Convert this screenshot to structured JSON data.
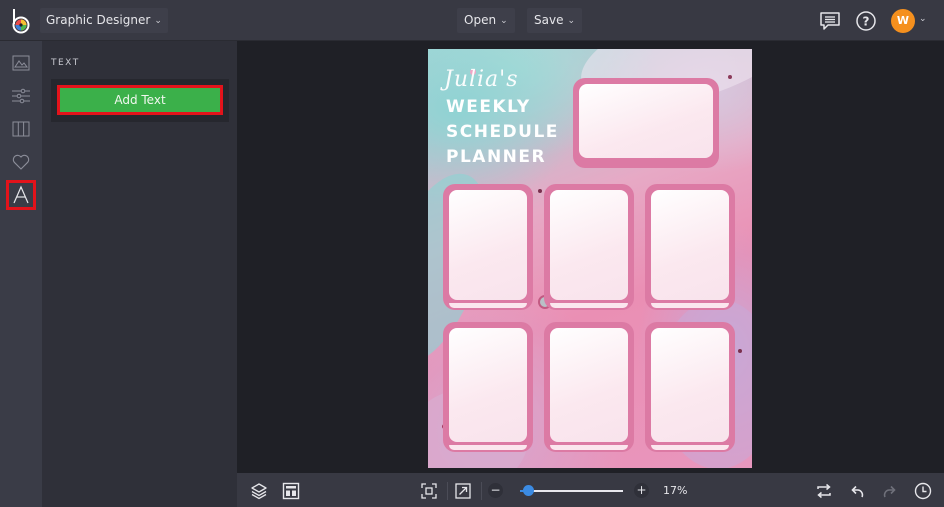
{
  "topbar": {
    "project_label": "Graphic Designer",
    "open_label": "Open",
    "save_label": "Save",
    "avatar_initial": "W",
    "caret": "⌄"
  },
  "rail": {
    "items": [
      {
        "name": "image"
      },
      {
        "name": "adjustments"
      },
      {
        "name": "layouts"
      },
      {
        "name": "favorites"
      },
      {
        "name": "text",
        "active": true
      }
    ]
  },
  "panel": {
    "title": "TEXT",
    "add_text_label": "Add Text"
  },
  "design": {
    "script_title": "Julia's",
    "lines": [
      "WEEKLY",
      "SCHEDULE",
      "PLANNER"
    ]
  },
  "bottombar": {
    "zoom_percent": 17,
    "zoom_label": "17%",
    "zoom_minus": "−",
    "zoom_plus": "+"
  },
  "colors": {
    "accent_green": "#3bb04a",
    "highlight_red": "#e3131b",
    "avatar_orange": "#f5901e",
    "slider_blue": "#3b8be3"
  }
}
